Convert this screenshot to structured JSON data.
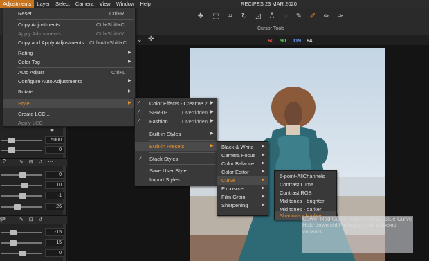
{
  "menubar": {
    "items": [
      "Adjustments",
      "Layer",
      "Select",
      "Camera",
      "View",
      "Window",
      "Help"
    ],
    "document_title": "RECIPES 23 MAR 2020"
  },
  "toolbar": {
    "label": "Cursor Tools",
    "icons": [
      "pan-icon",
      "select-icon",
      "crop-icon",
      "rotate-icon",
      "keystone-icon",
      "spot-icon",
      "brush-icon",
      "eraser-icon",
      "gradient-icon",
      "picker-icon",
      "color-picker-icon"
    ]
  },
  "readout": {
    "r": "60",
    "g": "90",
    "b": "119",
    "k": "84"
  },
  "colors": {
    "accent": "#e8902c",
    "r": "#ff5a4a",
    "g": "#5fd35f",
    "b": "#6aa0ff"
  },
  "left_panel": {
    "values": [
      "5000",
      "0",
      "0",
      "10",
      "-1",
      "-26",
      "-15",
      "15",
      "0"
    ],
    "header_label": "ge"
  },
  "adjustments_menu": {
    "items": [
      {
        "label": "Reset",
        "shortcut": "Ctrl+R"
      },
      {
        "label": "Copy Adjustments",
        "shortcut": "Ctrl+Shift+C"
      },
      {
        "label": "Apply Adjustments",
        "shortcut": "Ctrl+Shift+V"
      },
      {
        "label": "Copy and Apply Adjustments",
        "shortcut": "Ctrl+Alt+Shift+C"
      },
      {
        "label": "Rating"
      },
      {
        "label": "Color Tag"
      },
      {
        "label": "Auto Adjust",
        "shortcut": "Ctrl+L"
      },
      {
        "label": "Configure Auto Adjustments"
      },
      {
        "label": "Rotate"
      },
      {
        "label": "Style"
      },
      {
        "label": "Create LCC..."
      },
      {
        "label": "Apply LCC"
      }
    ]
  },
  "style_menu": {
    "items": [
      {
        "label": "Color Effects - Creative 2"
      },
      {
        "label": "SPR-03",
        "note": "Overridden"
      },
      {
        "label": "Fashion",
        "note": "Overridden"
      },
      {
        "label": "Built-in Styles"
      },
      {
        "label": "Built-in Presets"
      },
      {
        "label": "Stack Styles"
      },
      {
        "label": "Save User Style..."
      },
      {
        "label": "Import Styles..."
      }
    ]
  },
  "presets_menu": {
    "items": [
      "Black & White",
      "Camera Focus",
      "Color Balance",
      "Color Editor",
      "Curve",
      "Exposure",
      "Film Grain",
      "Sharpening"
    ]
  },
  "curve_menu": {
    "items": [
      "5-point-AllChannels",
      "Contrast Luma",
      "Contrast RGB",
      "Mid tones - brighter",
      "Mid tones - darker",
      "Shadows - brighter"
    ]
  },
  "tooltip": {
    "line1": "Curve, Red Curve, Green Curve, Blue Curve",
    "line2": "Hold down shift to apply to all selected variants"
  }
}
